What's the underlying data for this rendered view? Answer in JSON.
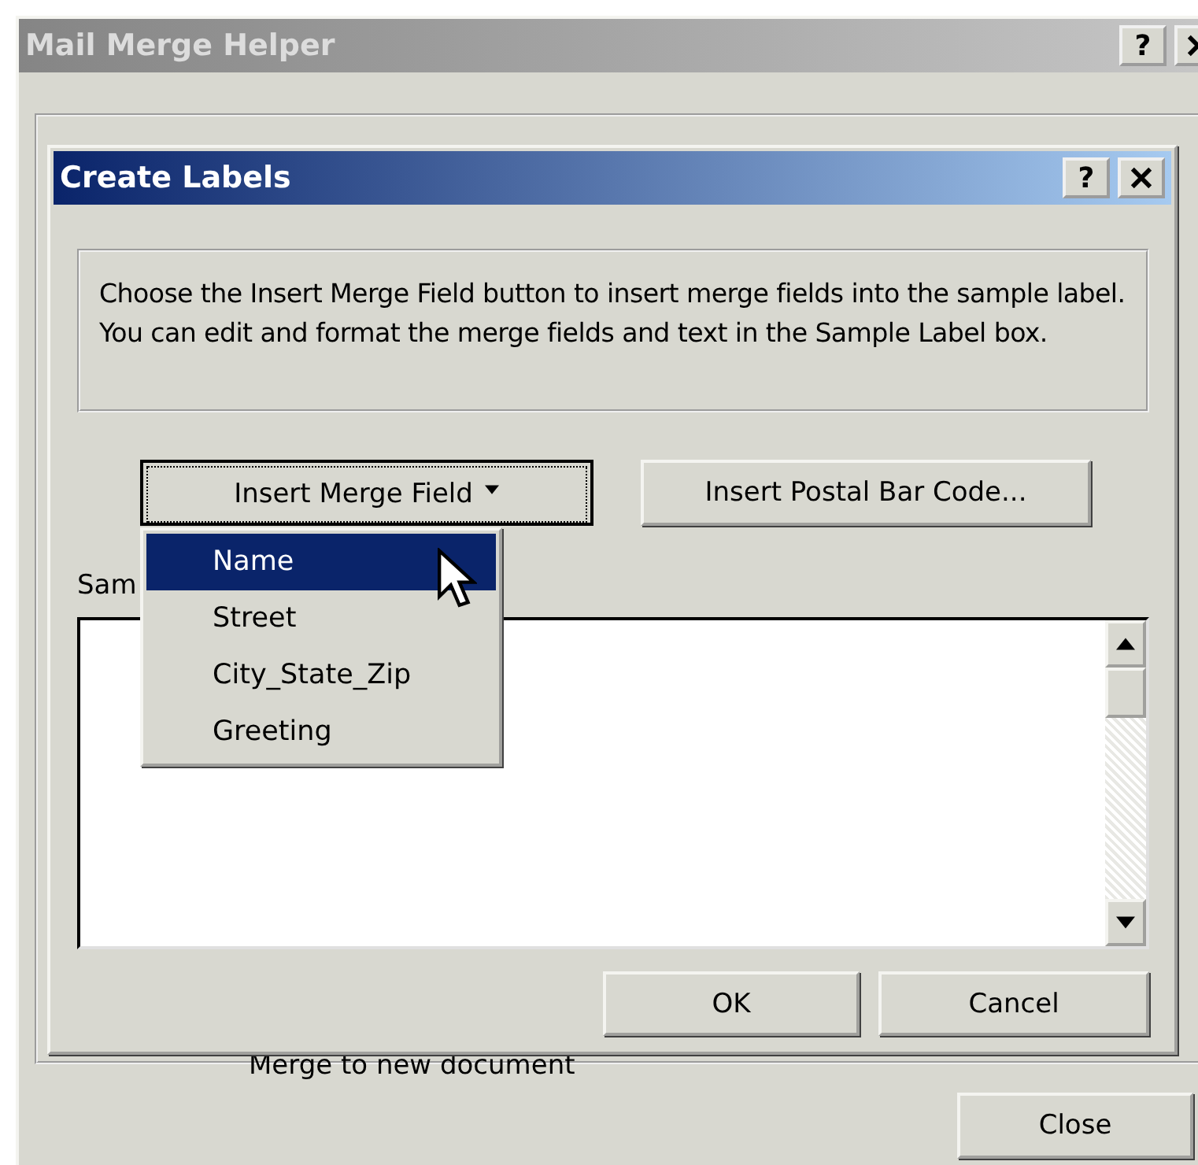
{
  "outer_window": {
    "title": "Mail Merge Helper",
    "active": false,
    "help_button": "?",
    "background_text": "Merge to new document",
    "close_label": "Close"
  },
  "dialog": {
    "title": "Create Labels",
    "active": true,
    "help_button": "?",
    "instructions": "Choose the Insert Merge Field button to insert merge fields into the sample label.  You can edit and format the merge fields and text in the Sample Label box.",
    "buttons": [
      {
        "label": "Insert Merge Field",
        "kind": "dropdown",
        "focused": true
      },
      {
        "label": "Insert Postal Bar Code...",
        "kind": "plain",
        "focused": false
      }
    ],
    "menu": [
      {
        "label": "Name",
        "selected": true
      },
      {
        "label": "Street",
        "selected": false
      },
      {
        "label": "City_State_Zip",
        "selected": false
      },
      {
        "label": "Greeting",
        "selected": false
      }
    ],
    "sample_label": "Sam",
    "footer_buttons": [
      "OK",
      "Cancel"
    ]
  }
}
